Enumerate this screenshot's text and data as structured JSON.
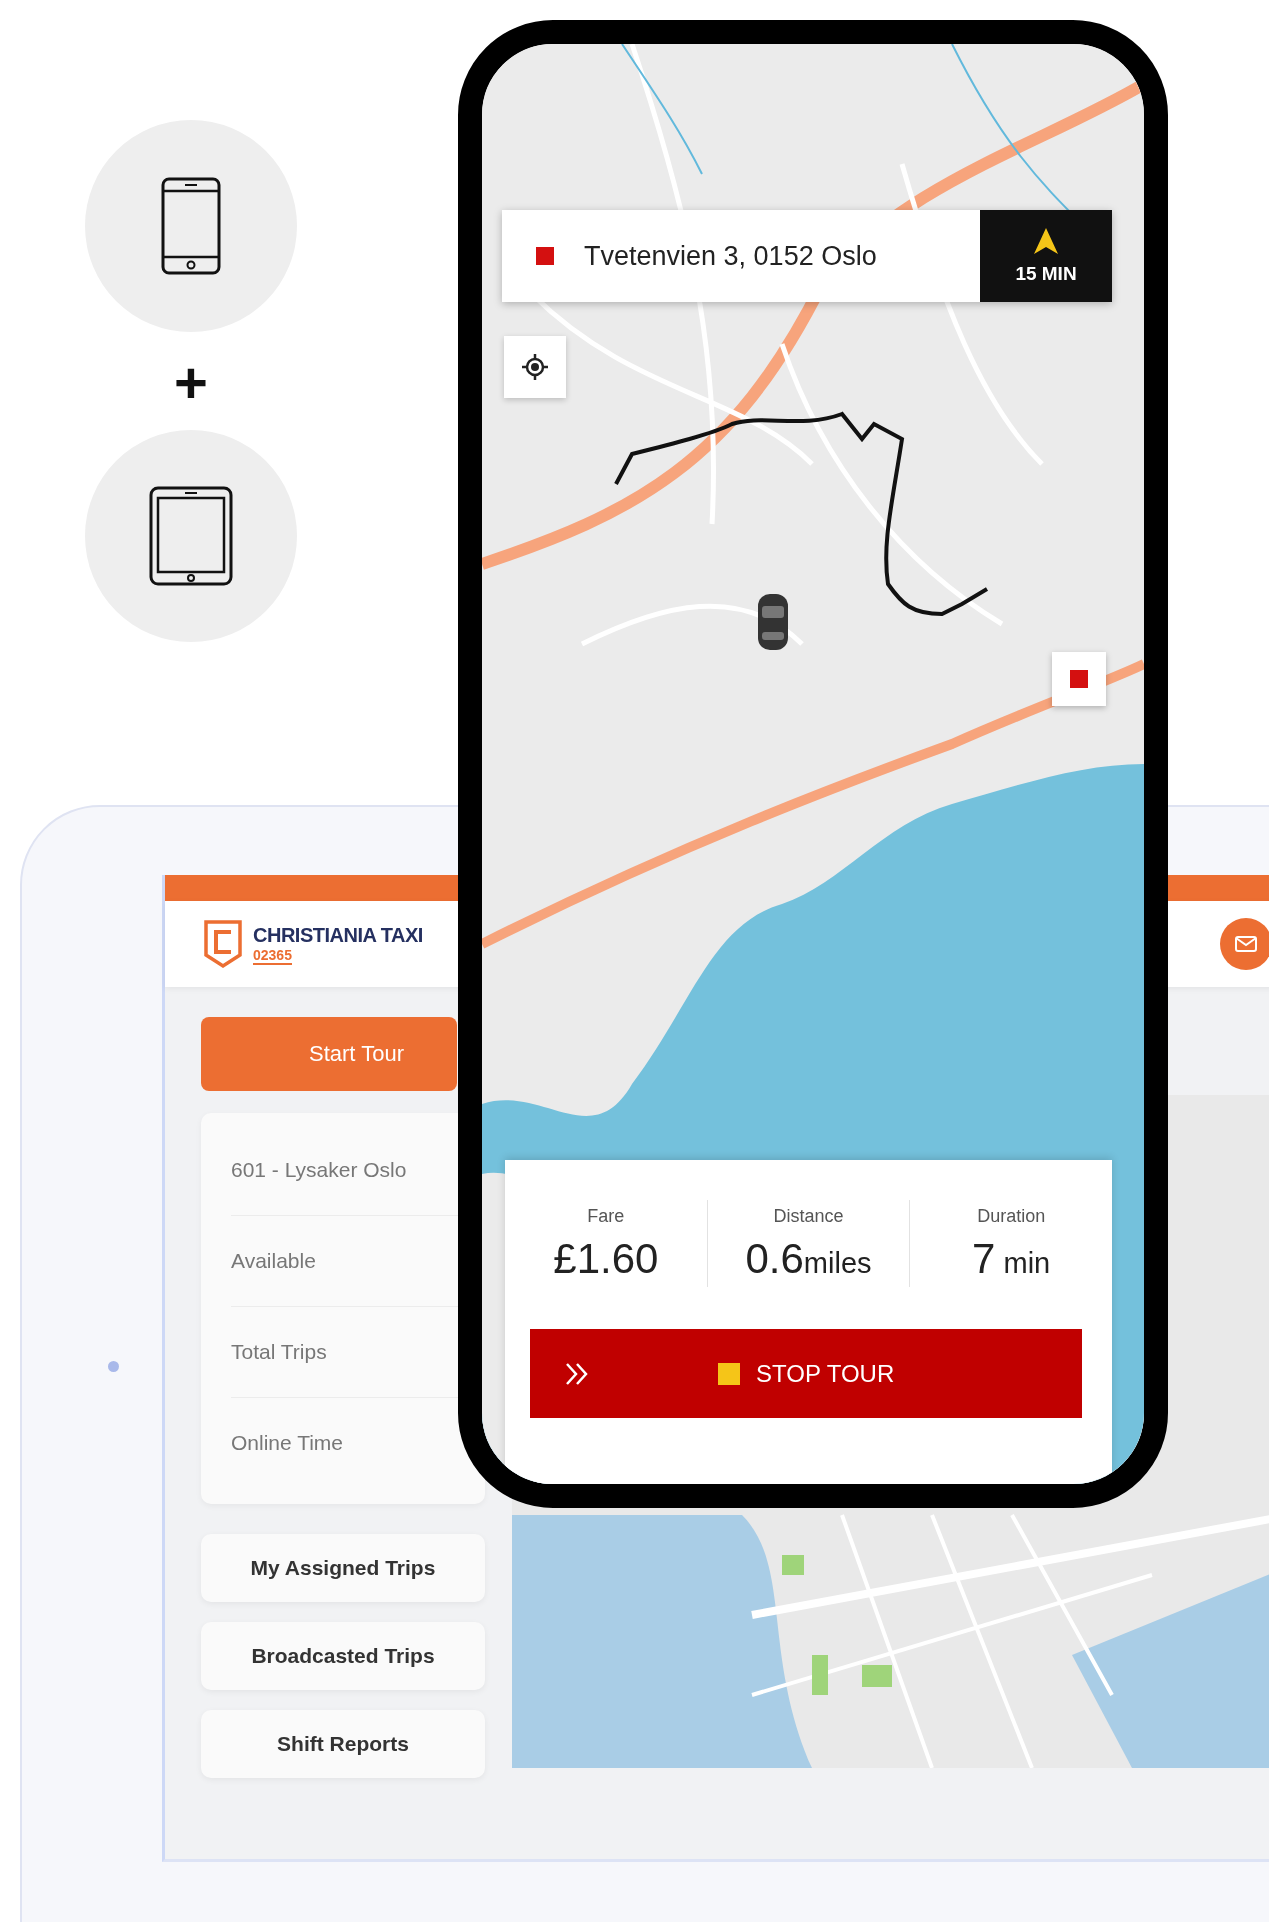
{
  "device_icons": [
    {
      "kind": "phone"
    },
    {
      "kind": "tablet"
    }
  ],
  "plus_sign": "+",
  "tablet": {
    "brand": {
      "name": "CHRISTIANIA TAXI",
      "number": "02365"
    },
    "start_button": "Start Tour",
    "info_rows": [
      "601 - Lysaker Oslo",
      "Available",
      "Total Trips",
      "Online Time"
    ],
    "menu_buttons": [
      "My Assigned Trips",
      "Broadcasted Trips",
      "Shift Reports"
    ]
  },
  "phone": {
    "destination": "Tvetenvien 3, 0152 Oslo",
    "eta": "15 MIN",
    "stats": [
      {
        "label": "Fare",
        "value": "£1.60"
      },
      {
        "label": "Distance",
        "value": "0.6",
        "unit": "miles"
      },
      {
        "label": "Duration",
        "value": "7",
        "unit": " min"
      }
    ],
    "stop_button": "STOP TOUR"
  }
}
